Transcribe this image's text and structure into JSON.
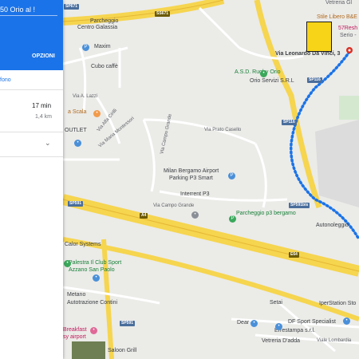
{
  "panel": {
    "destination": "50 Orio al !",
    "options_label": "OPZIONI",
    "phone_label": "fono",
    "duration": "17 min",
    "distance": "1,4 km",
    "expand_icon": "chevron-down-icon"
  },
  "places": {
    "parcheggio_galassia": "Parcheggio",
    "parcheggio_galassia_2": "Centro Galassia",
    "maxim": "Maxim",
    "cubo": "Cubo caffè",
    "via_lazzi": "Via A. Lazzi",
    "la_scala": "a Scala",
    "via_cirilli": "Via Alfa Cirilli",
    "via_montessori": "Via Maria Montessori",
    "outlet": "OUTLET",
    "via_campo_grande": "Via Campo Grande",
    "via_campo_grande_2": "Via Campo Grande",
    "via_prato_casello": "Via Prato Casello",
    "airport_parking_1": "Milan Bergamo Airport",
    "airport_parking_2": "Parking P3 Smart",
    "interrent": "Interrent P3",
    "parcheggio_p3": "Parcheggio p3 bergamo",
    "calor": "Calor Systems",
    "palestra_1": "Palestra Il Club Sport",
    "palestra_2": "Azzano San Paolo",
    "metano_1": "Metano",
    "metano_2": "Autotrazione Contini",
    "breakfast_1": "Breakfast",
    "breakfast_2": "sy airport",
    "saloon": "Saloon Grill",
    "asd_rugby": "A.S.D. Rugby Orio",
    "orio_servizi": "Orio Servizi S.R.L",
    "via_leonardo": "Via Leonardo Da Vinci, 3",
    "stile_libero": "Stile Libero B&E",
    "57resh": "57Resh",
    "serio": "Serio -",
    "vetreria_top": "Vetreria Gl",
    "autonoleggio": "Autonoleggio",
    "setai": "Setai",
    "iperstation": "IperStation Sto",
    "dear": "Dear",
    "df_sport": "DF Sport Specialist",
    "errestampa": "Errestampa s.r.l.",
    "vetreria_odda": "Vetreria D'adda",
    "viale_lombardia": "Viale Lombardia"
  },
  "shields": {
    "sp671": "SP671",
    "ss671": "SS671",
    "sp116": "SP116",
    "sp116_2": "SP116",
    "sp591": "SP591",
    "sp591bis": "SP591bis",
    "sp591_2": "SP591",
    "a4": "A4",
    "e64": "E64"
  },
  "colors": {
    "route": "#1a73e8",
    "highway": "#f6d54f",
    "panel_header": "#1a73e8",
    "destination_pin": "#d93025"
  }
}
